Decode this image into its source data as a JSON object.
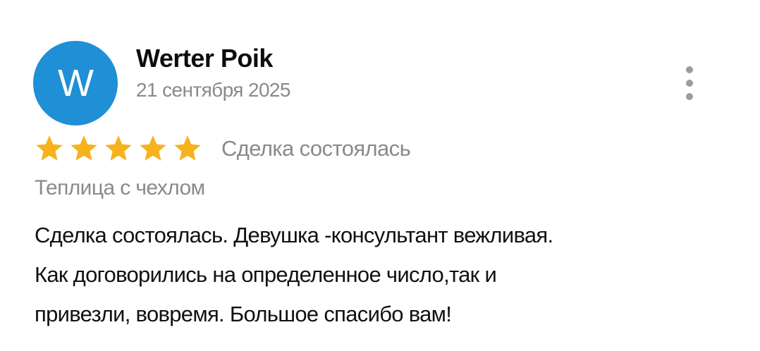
{
  "review": {
    "avatar_letter": "W",
    "avatar_color": "#1f8fd6",
    "author": "Werter Poik",
    "date": "21 сентября 2025",
    "menu_icon": "more-vertical-icon",
    "rating": 5,
    "rating_max": 5,
    "star_color": "#f7b21c",
    "status": "Сделка состоялась",
    "product": "Теплица с чехлом",
    "text_lines": [
      "Сделка состоялась. Девушка -консультант вежливая.",
      "Как договорились на определенное число,так и",
      "привезли, вовремя. Большое спасибо вам!"
    ]
  }
}
